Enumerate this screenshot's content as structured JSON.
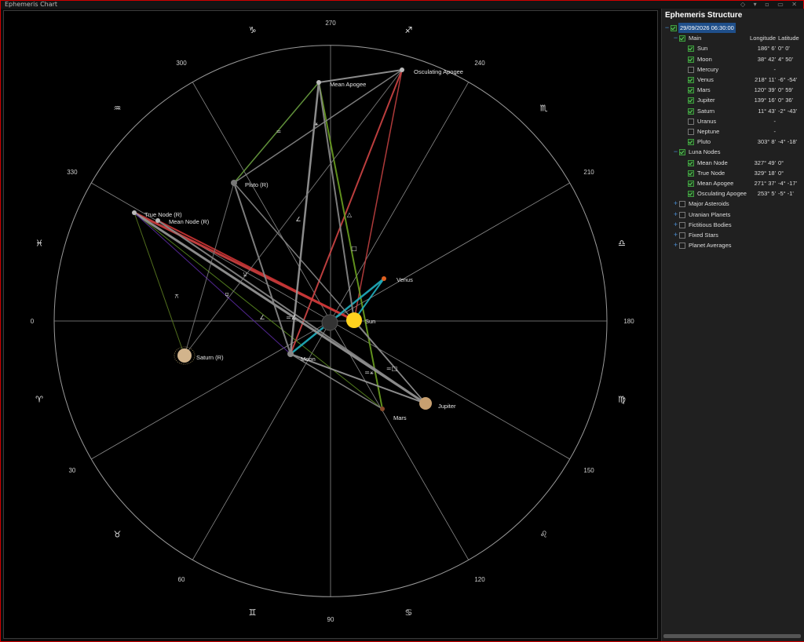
{
  "window": {
    "title": "Ephemeris Chart"
  },
  "chart": {
    "degree_labels": [
      "0",
      "30",
      "60",
      "90",
      "120",
      "150",
      "180",
      "210",
      "240",
      "270",
      "300",
      "330"
    ],
    "sign_glyphs": [
      {
        "sign": "aries",
        "glyph": "♈"
      },
      {
        "sign": "taurus",
        "glyph": "♉"
      },
      {
        "sign": "gemini",
        "glyph": "♊"
      },
      {
        "sign": "cancer",
        "glyph": "♋"
      },
      {
        "sign": "leo",
        "glyph": "♌"
      },
      {
        "sign": "virgo",
        "glyph": "♍"
      },
      {
        "sign": "libra",
        "glyph": "♎"
      },
      {
        "sign": "scorpio",
        "glyph": "♏"
      },
      {
        "sign": "sagittarius",
        "glyph": "♐"
      },
      {
        "sign": "capricorn",
        "glyph": "♑"
      },
      {
        "sign": "aquarius",
        "glyph": "♒"
      },
      {
        "sign": "pisces",
        "glyph": "♓"
      }
    ],
    "bodies": [
      {
        "id": "sun",
        "label": "Sun",
        "color": "#ffd21e"
      },
      {
        "id": "moon",
        "label": "Moon",
        "color": "#888888"
      },
      {
        "id": "venus",
        "label": "Venus",
        "color": "#e06020"
      },
      {
        "id": "mars",
        "label": "Mars",
        "color": "#8a4a2a"
      },
      {
        "id": "jupiter",
        "label": "Jupiter",
        "color": "#c8a070"
      },
      {
        "id": "saturn",
        "label": "Saturn (R)",
        "color": "#d2b48c"
      },
      {
        "id": "pluto",
        "label": "Pluto (R)",
        "color": "#777777"
      },
      {
        "id": "mean-apogee",
        "label": "Mean Apogee",
        "color": "#bbbbbb"
      },
      {
        "id": "osc-apogee",
        "label": "Osculating Apogee",
        "color": "#bbbbbb"
      },
      {
        "id": "true-node",
        "label": "True Node (R)",
        "color": "#bbbbbb"
      },
      {
        "id": "mean-node",
        "label": "Mean Node (R)",
        "color": "#bbbbbb"
      }
    ],
    "aspect_glyphs": [
      "=",
      "⚹",
      "△",
      "□",
      "∠",
      "⚺",
      "⚻",
      "⚼",
      "∠",
      "=∠",
      "=⚹",
      "=□"
    ]
  },
  "tree": {
    "title": "Ephemeris Structure",
    "date": "29/09/2026 06:30:00",
    "group_main": "Main",
    "col_longitude": "Longitude",
    "col_latitude": "Latitude",
    "main_items": [
      {
        "name": "Sun",
        "checked": true,
        "lon": "186° 6'",
        "lat": "0° 0'"
      },
      {
        "name": "Moon",
        "checked": true,
        "lon": "38° 42'",
        "lat": "4° 50'"
      },
      {
        "name": "Mercury",
        "checked": false,
        "lon": "-",
        "lat": ""
      },
      {
        "name": "Venus",
        "checked": true,
        "lon": "218° 11'",
        "lat": "-6° -54'"
      },
      {
        "name": "Mars",
        "checked": true,
        "lon": "120° 39'",
        "lat": "0° 59'"
      },
      {
        "name": "Jupiter",
        "checked": true,
        "lon": "139° 16'",
        "lat": "0° 36'"
      },
      {
        "name": "Saturn",
        "checked": true,
        "lon": "11° 43'",
        "lat": "-2° -43'"
      },
      {
        "name": "Uranus",
        "checked": false,
        "lon": "-",
        "lat": ""
      },
      {
        "name": "Neptune",
        "checked": false,
        "lon": "-",
        "lat": ""
      },
      {
        "name": "Pluto",
        "checked": true,
        "lon": "303° 8'",
        "lat": "-4° -18'"
      }
    ],
    "group_luna": "Luna Nodes",
    "luna_items": [
      {
        "name": "Mean Node",
        "checked": true,
        "lon": "327° 49'",
        "lat": "0°"
      },
      {
        "name": "True Node",
        "checked": true,
        "lon": "329° 18'",
        "lat": "0°"
      },
      {
        "name": "Mean Apogee",
        "checked": true,
        "lon": "271° 37'",
        "lat": "-4° -17'"
      },
      {
        "name": "Osculating Apogee",
        "checked": true,
        "lon": "253° 5'",
        "lat": "-5° -1'"
      }
    ],
    "other_groups": [
      "Major Asteroids",
      "Uranian Planets",
      "Fictitious Bodies",
      "Fixed Stars",
      "Planet Averages"
    ]
  }
}
